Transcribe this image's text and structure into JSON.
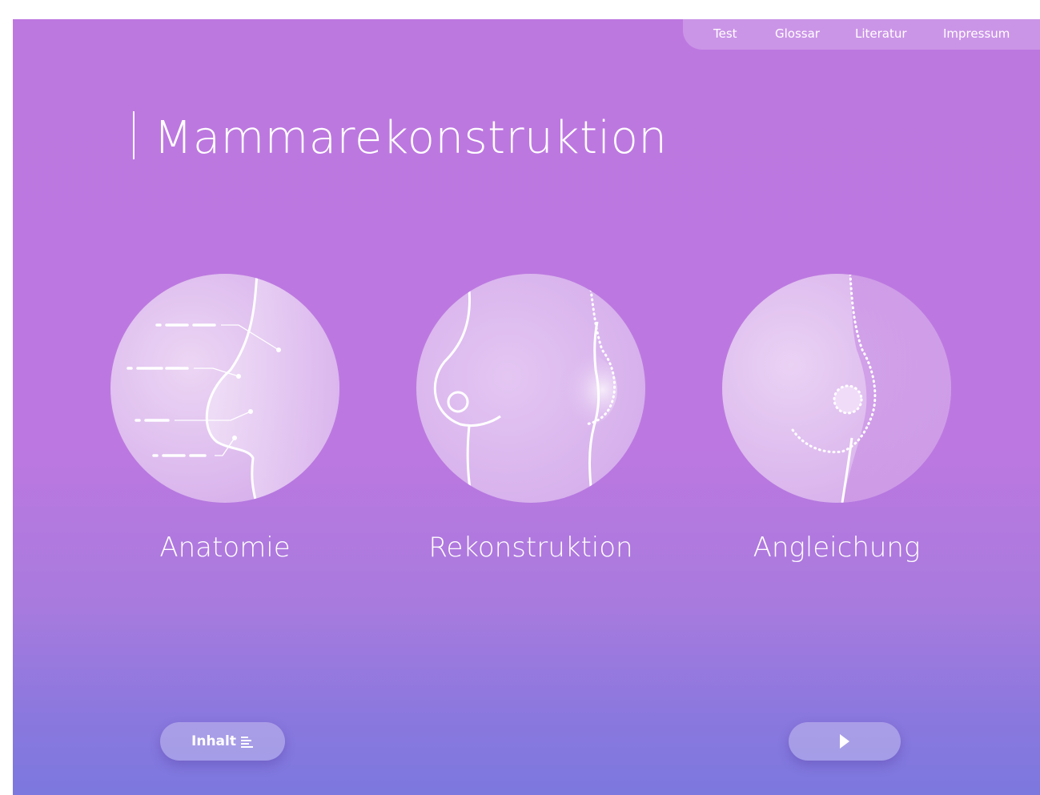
{
  "nav": {
    "items": [
      {
        "label": "Test"
      },
      {
        "label": "Glossar"
      },
      {
        "label": "Literatur"
      },
      {
        "label": "Impressum"
      }
    ]
  },
  "page": {
    "title": "Mammarekonstruktion"
  },
  "topics": [
    {
      "label": "Anatomie",
      "icon": "anatomy-illustration-icon"
    },
    {
      "label": "Rekonstruktion",
      "icon": "reconstruction-illustration-icon"
    },
    {
      "label": "Angleichung",
      "icon": "adjustment-illustration-icon"
    }
  ],
  "footer": {
    "contents_label": "Inhalt",
    "contents_icon": "list-icon",
    "next_icon": "play-icon"
  },
  "colors": {
    "background_top": "#bd78e0",
    "background_bottom": "#7c78de",
    "text": "#ffffff"
  }
}
